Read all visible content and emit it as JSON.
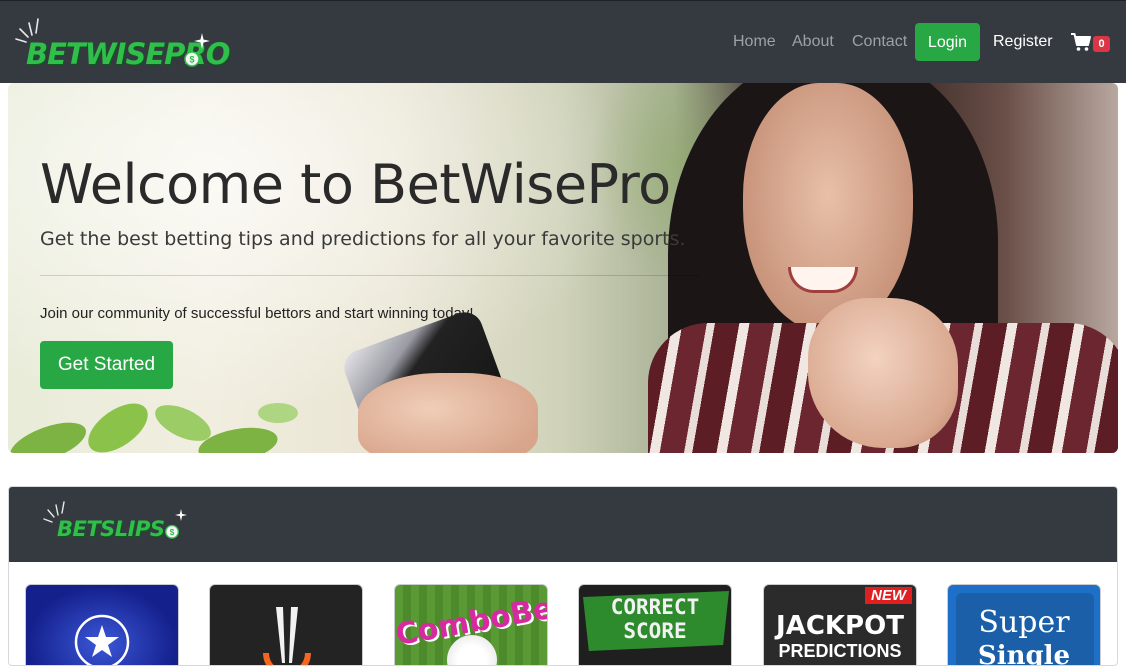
{
  "navbar": {
    "brand": "BETWISEPRO",
    "links": [
      "Home",
      "About",
      "Contact"
    ],
    "login_label": "Login",
    "register_label": "Register",
    "cart_count": "0"
  },
  "hero": {
    "title": "Welcome to BetWisePro",
    "lead": "Get the best betting tips and predictions for all your favorite sports.",
    "subtext": "Join our community of successful bettors and start winning today!",
    "cta_label": "Get Started"
  },
  "betslips": {
    "logo": "BETSLIPS",
    "cards": [
      {
        "label": ""
      },
      {
        "label": ""
      },
      {
        "label": "ComboBet"
      },
      {
        "label": "CORRECT SCORE"
      },
      {
        "badge": "NEW",
        "label": "JACKPOT",
        "label2": "PREDICTIONS"
      },
      {
        "label": "Super",
        "label2": "Single"
      }
    ]
  },
  "colors": {
    "navbar": "#343a40",
    "accent_green": "#28a745",
    "badge_red": "#dc3545"
  }
}
